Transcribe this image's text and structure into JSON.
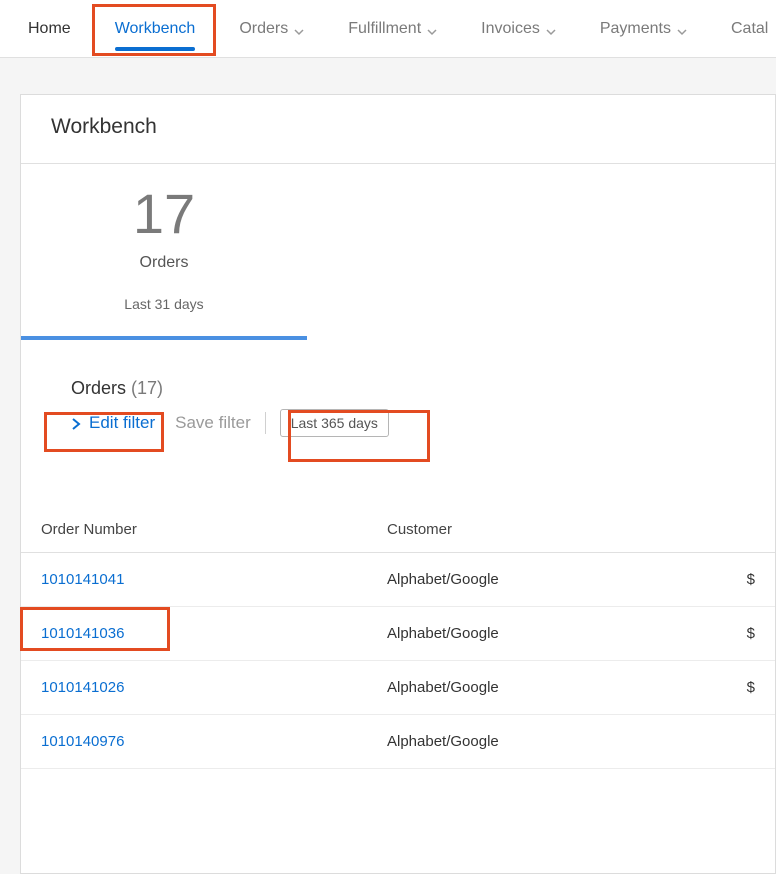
{
  "nav": {
    "home": "Home",
    "workbench": "Workbench",
    "orders": "Orders",
    "fulfillment": "Fulfillment",
    "invoices": "Invoices",
    "payments": "Payments",
    "catalogs": "Catal"
  },
  "page": {
    "title": "Workbench"
  },
  "summary": {
    "count": "17",
    "label": "Orders",
    "sub": "Last 31 days"
  },
  "section": {
    "title": "Orders",
    "count_wrapped": "(17)"
  },
  "filters": {
    "edit_label": "Edit filter",
    "save_label": "Save filter",
    "pill": "Last 365 days"
  },
  "table": {
    "headers": {
      "order": "Order Number",
      "customer": "Customer",
      "amount": "$"
    },
    "rows": [
      {
        "order": "1010141041",
        "customer": "Alphabet/Google",
        "amount": "$"
      },
      {
        "order": "1010141036",
        "customer": "Alphabet/Google",
        "amount": "$"
      },
      {
        "order": "1010141026",
        "customer": "Alphabet/Google",
        "amount": "$"
      },
      {
        "order": "1010140976",
        "customer": "Alphabet/Google",
        "amount": ""
      }
    ]
  }
}
